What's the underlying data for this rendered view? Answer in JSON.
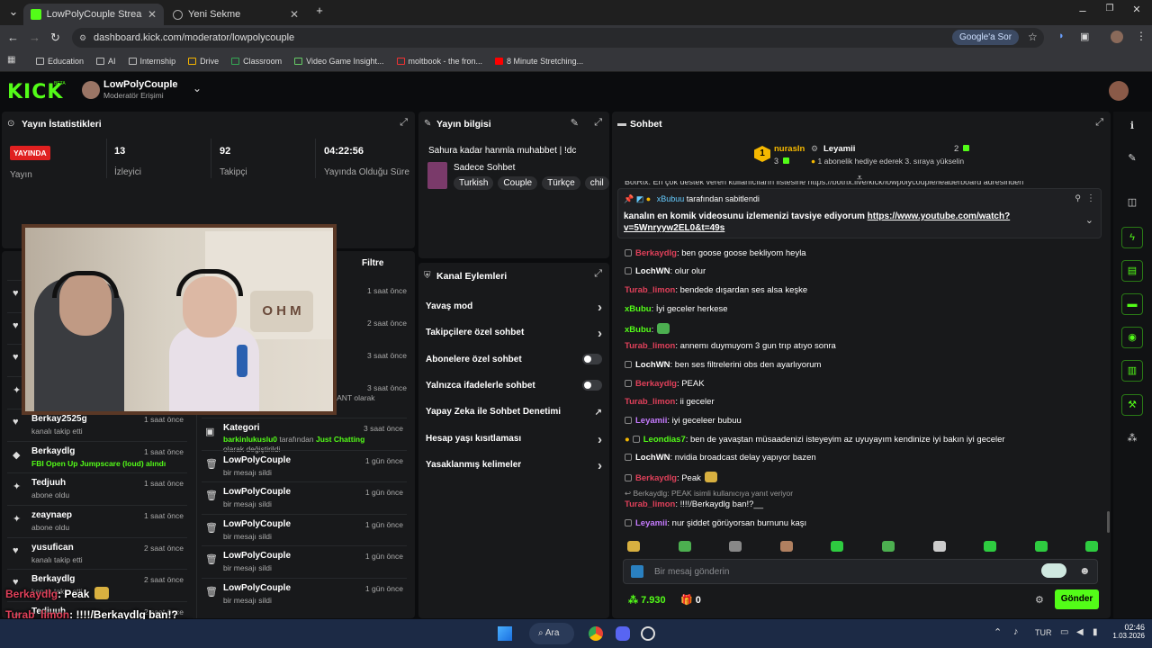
{
  "browser": {
    "tabs": [
      {
        "title": "LowPolyCouple Stream - Kick D",
        "active": true
      },
      {
        "title": "Yeni Sekme",
        "active": false
      }
    ],
    "new_tab": "+",
    "window_controls": [
      "–",
      "❐",
      "✕"
    ],
    "url": "dashboard.kick.com/moderator/lowpolycouple",
    "ask_google": "Google'a Sor",
    "bookmarks": [
      "Education",
      "AI",
      "Internship",
      "Drive",
      "Classroom",
      "Video Game Insight...",
      "moltbook - the fron...",
      "8 Minute Stretching..."
    ]
  },
  "header": {
    "logo": "KICK",
    "beta": "BETA",
    "channel_name": "LowPolyCouple",
    "role": "Moderatör Erişimi"
  },
  "stats": {
    "title": "Yayın İstatistikleri",
    "live_badge": "YAYINDA",
    "items": [
      {
        "value": "",
        "label": "Yayın"
      },
      {
        "value": "13",
        "label": "İzleyici"
      },
      {
        "value": "92",
        "label": "Takipçi"
      },
      {
        "value": "04:22:56",
        "label": "Yayında Olduğu Süre"
      }
    ]
  },
  "stream_info": {
    "title": "Yayın bilgisi",
    "stream_title": "Sahura kadar hanmla muhabbet | !dc",
    "category": "Sadece Sohbet",
    "tags": [
      "Turkish",
      "Couple",
      "Türkçe",
      "chil"
    ]
  },
  "activity": {
    "filter": "Filtre",
    "left": [
      {
        "icon": "♥",
        "name": "",
        "detail": "",
        "time": "1 saat önce"
      },
      {
        "icon": "♥",
        "name": "",
        "detail": "",
        "time": "2 saat önce"
      },
      {
        "icon": "♥",
        "name": "",
        "detail": "",
        "time": "3 saat önce"
      },
      {
        "icon": "✦",
        "name": "",
        "detail": "",
        "time": "3 saat önce"
      },
      {
        "icon": "♥",
        "name": "Berkay2525g",
        "detail": "kanalı takip etti",
        "time": "1 saat önce"
      },
      {
        "icon": "◆",
        "name": "Berkaydlg",
        "detail": "FBI Open Up Jumpscare (loud) alındı",
        "time": "1 saat önce"
      },
      {
        "icon": "✦",
        "name": "Tedjuuh",
        "detail": "abone oldu",
        "time": "1 saat önce"
      },
      {
        "icon": "✦",
        "name": "zeaynaep",
        "detail": "abone oldu",
        "time": "1 saat önce"
      },
      {
        "icon": "♥",
        "name": "yusufican",
        "detail": "kanalı takip etti",
        "time": "2 saat önce"
      },
      {
        "icon": "♥",
        "name": "Berkaydlg",
        "detail": "kanalı takip etti",
        "time": "2 saat önce"
      },
      {
        "icon": "✦",
        "name": "Tedjuuh",
        "detail": "",
        "time": "2 saat önce"
      }
    ],
    "right_partial": "RANT olarak",
    "right": [
      {
        "name": "Kategori",
        "detail_user": "barkinlukuslu0",
        "detail_mid": " tarafından ",
        "detail_cat": "Just Chatting",
        "detail_end": " olarak değiştirildi",
        "time": "3 saat önce"
      },
      {
        "name": "LowPolyCouple",
        "detail": "bir mesajı sildi",
        "time": "1 gün önce"
      },
      {
        "name": "LowPolyCouple",
        "detail": "bir mesajı sildi",
        "time": "1 gün önce"
      },
      {
        "name": "LowPolyCouple",
        "detail": "bir mesajı sildi",
        "time": "1 gün önce"
      },
      {
        "name": "LowPolyCouple",
        "detail": "bir mesajı sildi",
        "time": "1 gün önce"
      },
      {
        "name": "LowPolyCouple",
        "detail": "bir mesajı sildi",
        "time": "1 gün önce"
      }
    ],
    "right_times_top": [
      "1 saat önce",
      "2 saat önce",
      "3 saat önce",
      "3 saat önce"
    ]
  },
  "channel_actions": {
    "title": "Kanal Eylemleri",
    "rows": [
      {
        "label": "Yavaş mod",
        "control": "chevron"
      },
      {
        "label": "Takipçilere özel sohbet",
        "control": "chevron"
      },
      {
        "label": "Abonelere özel sohbet",
        "control": "toggle"
      },
      {
        "label": "Yalnızca ifadelerle sohbet",
        "control": "toggle"
      },
      {
        "label": "Yapay Zeka ile Sohbet Denetimi",
        "control": "external"
      },
      {
        "label": "Hesap yaşı kısıtlaması",
        "control": "chevron"
      },
      {
        "label": "Yasaklanmış kelimeler",
        "control": "chevron"
      }
    ]
  },
  "chat": {
    "title": "Sohbet",
    "leader1": {
      "rank": "1",
      "name": "nurasIn",
      "count": "3"
    },
    "leader2": {
      "name": "Leyamii",
      "count": "2",
      "note": "1 abonelik hediye ederek 3. sıraya yükselin"
    },
    "partial_top": "BotRix: En çok destek veren kullanıcıların listesine https://botrix.live/kick/lowpolycouple/leaderboard adresinden",
    "pinned": {
      "by_user": "xBubuu",
      "by_text": "tarafından sabitlendi",
      "text": "kanalın en komik videosunu izlemenizi tavsiye ediyorum",
      "link1": "https://www.youtube.com/watch?",
      "link2": "v=5Wnryyw2EL0&t=49s"
    },
    "messages": [
      {
        "user": "Berkaydlg",
        "color": "#e0405a",
        "text": ": ben goose goose bekliyom heyla"
      },
      {
        "user": "LochWN",
        "color": "#ffffff",
        "text": ": olur olur"
      },
      {
        "user": "Turab_limon",
        "color": "#e0405a",
        "text": ": bendede dışardan ses alsa keşke"
      },
      {
        "user": "xBubu",
        "color": "#53fc18",
        "text": ": İyi geceler herkese"
      },
      {
        "user": "xBubu",
        "color": "#53fc18",
        "text": ":"
      },
      {
        "user": "Turab_limon",
        "color": "#e0405a",
        "text": ": annemı duymuyom 3 gun trıp atıyo sonra"
      },
      {
        "user": "LochWN",
        "color": "#ffffff",
        "text": ": ben ses filtrelerini obs den ayarlıyorum"
      },
      {
        "user": "Berkaydlg",
        "color": "#e0405a",
        "text": ": PEAK"
      },
      {
        "user": "Turab_limon",
        "color": "#e0405a",
        "text": ": ii geceler"
      },
      {
        "user": "Leyamii",
        "color": "#c67bff",
        "text": ": iyi geceleer bubuu"
      },
      {
        "user": "Leondias7",
        "color": "#53fc18",
        "text": ": ben de yavaştan müsaadenizi isteyeyim az uyuyayım kendinize iyi bakın iyi geceler"
      },
      {
        "user": "LochWN",
        "color": "#ffffff",
        "text": ": nvidia broadcast delay yapıyor bazen"
      },
      {
        "user": "Berkaydlg",
        "color": "#e0405a",
        "text": ": Peak"
      },
      {
        "user": "Turab_limon",
        "color": "#e0405a",
        "text": ": !!!!/Berkaydlg ban!?__"
      },
      {
        "user": "Leyamii",
        "color": "#c67bff",
        "text": ": nur şiddet görüyorsan burnunu kaşı"
      }
    ],
    "reply_note": "Berkaydlg: PEAK isimli kullanıcıya yanıt veriyor",
    "input_placeholder": "Bir mesaj gönderin",
    "points": "7.930",
    "gift_count": "0",
    "send_label": "Gönder"
  },
  "overlay": {
    "lines": [
      {
        "user": "Berkaydlg",
        "color": "#e0405a",
        "text": ": Peak"
      },
      {
        "user": "Turab_limon",
        "color": "#e0405a",
        "text": ": !!!!/Berkaydlg ban!?__"
      },
      {
        "user": "Leyamii",
        "color": "#c67bff",
        "text": ": nur şiddet görüyorsan burnunu kaşı"
      }
    ],
    "webcam_sign": "O H M"
  },
  "taskbar": {
    "search": "Ara",
    "lang": "TUR",
    "time": "02:46",
    "date": "1.03.2026"
  },
  "colors": {
    "accent": "#53fc18",
    "live": "#e02020",
    "panel": "#18191b"
  }
}
